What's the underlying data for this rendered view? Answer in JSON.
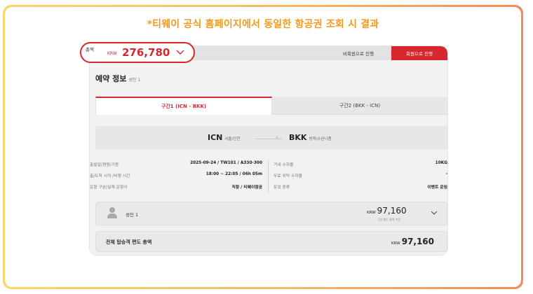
{
  "headline": "*티웨이 공식 홈페이지에서 동일한 항공권 조회 시 결과",
  "header_buttons": {
    "nonmember": "비회원으로 진행",
    "member": "회원으로 진행"
  },
  "summary": {
    "label": "총액",
    "currency": "KRW",
    "amount": "276,780"
  },
  "reservation": {
    "title": "예약 정보",
    "subtitle": "성인 1"
  },
  "tabs": [
    {
      "label": "구간1 (ICN - BKK)",
      "active": true
    },
    {
      "label": "구간2 (BKK - ICN)",
      "active": false
    }
  ],
  "route": {
    "from_code": "ICN",
    "from_name": "서울/인천",
    "to_code": "BKK",
    "to_name": "방콕/수완나품"
  },
  "details_left": [
    {
      "label": "출발일/편명/기종",
      "value": "2025-09-24 / TW101 / A330-300"
    },
    {
      "label": "출/도착 시각 /비행 시간",
      "value": "18:00 ~ 22:05 / 06h 05m"
    },
    {
      "label": "운항 구분/실제 운항사",
      "value": "직항 / 티웨이항공"
    }
  ],
  "details_right": [
    {
      "label": "기내 수하물",
      "value": "10KG"
    },
    {
      "label": "무료 위탁 수하물",
      "value": "-"
    },
    {
      "label": "운임 종류",
      "value": "이벤트 운임"
    }
  ],
  "passenger": {
    "label": "성인 1",
    "currency": "KRW",
    "price": "97,160",
    "note": "1인 편도 총액 기준"
  },
  "total": {
    "label": "전체 탑승객 편도 총액",
    "currency": "KRW",
    "price": "97,160"
  },
  "colors": {
    "brand_red": "#d7262e",
    "headline_orange": "#f19a1c",
    "highlight_red": "#e02424"
  },
  "icons": {
    "dropdown": "chevron-down-icon",
    "person": "person-icon",
    "arrow": "arrow-right-icon"
  }
}
